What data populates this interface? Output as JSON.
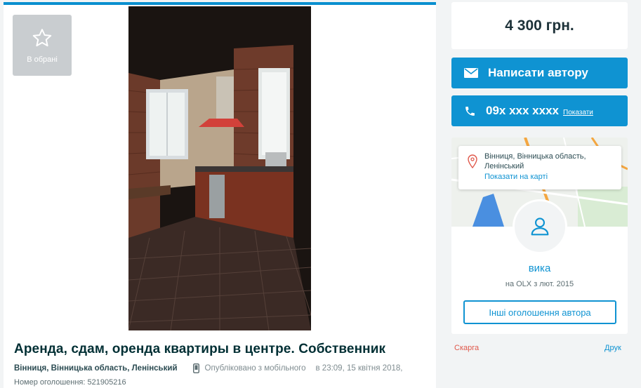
{
  "favorite": {
    "label": "В обрані",
    "icon": "star-outline-icon"
  },
  "listing": {
    "title": "Аренда, сдам, оренда квартиры в центре. Собственник",
    "location": "Вінниця, Вінницька область, Ленінський",
    "published": "Опубліковано з мобільного",
    "time": "в 23:09, 15 квітня 2018,",
    "ad_number": "Номер оголошення: 521905216"
  },
  "price": "4 300 грн.",
  "actions": {
    "message_label": "Написати автору",
    "phone_number": "09x xxx xxxx",
    "phone_show": "Показати"
  },
  "map": {
    "address_line1": "Вінниця, Вінницька область,",
    "address_line2": "Ленінський",
    "show_on_map": "Показати на карті"
  },
  "seller": {
    "name": "вика",
    "since": "на OLX з лют. 2015",
    "other_ads": "Інші оголошення автора"
  },
  "footer": {
    "complain": "Скарга",
    "print": "Друк"
  },
  "colors": {
    "accent": "#0f93d2",
    "complain": "#e0584b",
    "map_water": "#4a8fe0",
    "map_road": "#f4a640"
  }
}
